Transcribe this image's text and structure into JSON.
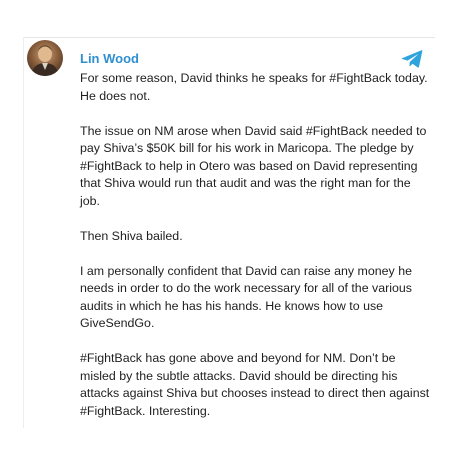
{
  "post": {
    "author": "Lin Wood",
    "avatar_icon": "user-avatar",
    "source_icon": "telegram-icon",
    "accent_color": "#2f8fd0",
    "paragraphs": [
      "For some reason, David thinks he speaks for #FightBack today. He does not.",
      "The issue on NM arose when David said #FightBack needed to pay Shiva’s $50K bill for his work in Maricopa. The pledge by #FightBack to help in Otero was based on David representing that Shiva would run that audit and was the right man for the job.",
      "Then Shiva bailed.",
      "I am personally confident that David can raise any money he needs in order to do the work necessary for all of the various audits in which he has his hands. He knows how to use GiveSendGo.",
      "#FightBack has gone above and beyond for NM. Don’t be misled by the subtle attacks. David should be directing his attacks against Shiva but chooses instead to direct then against #FightBack. Interesting."
    ]
  }
}
